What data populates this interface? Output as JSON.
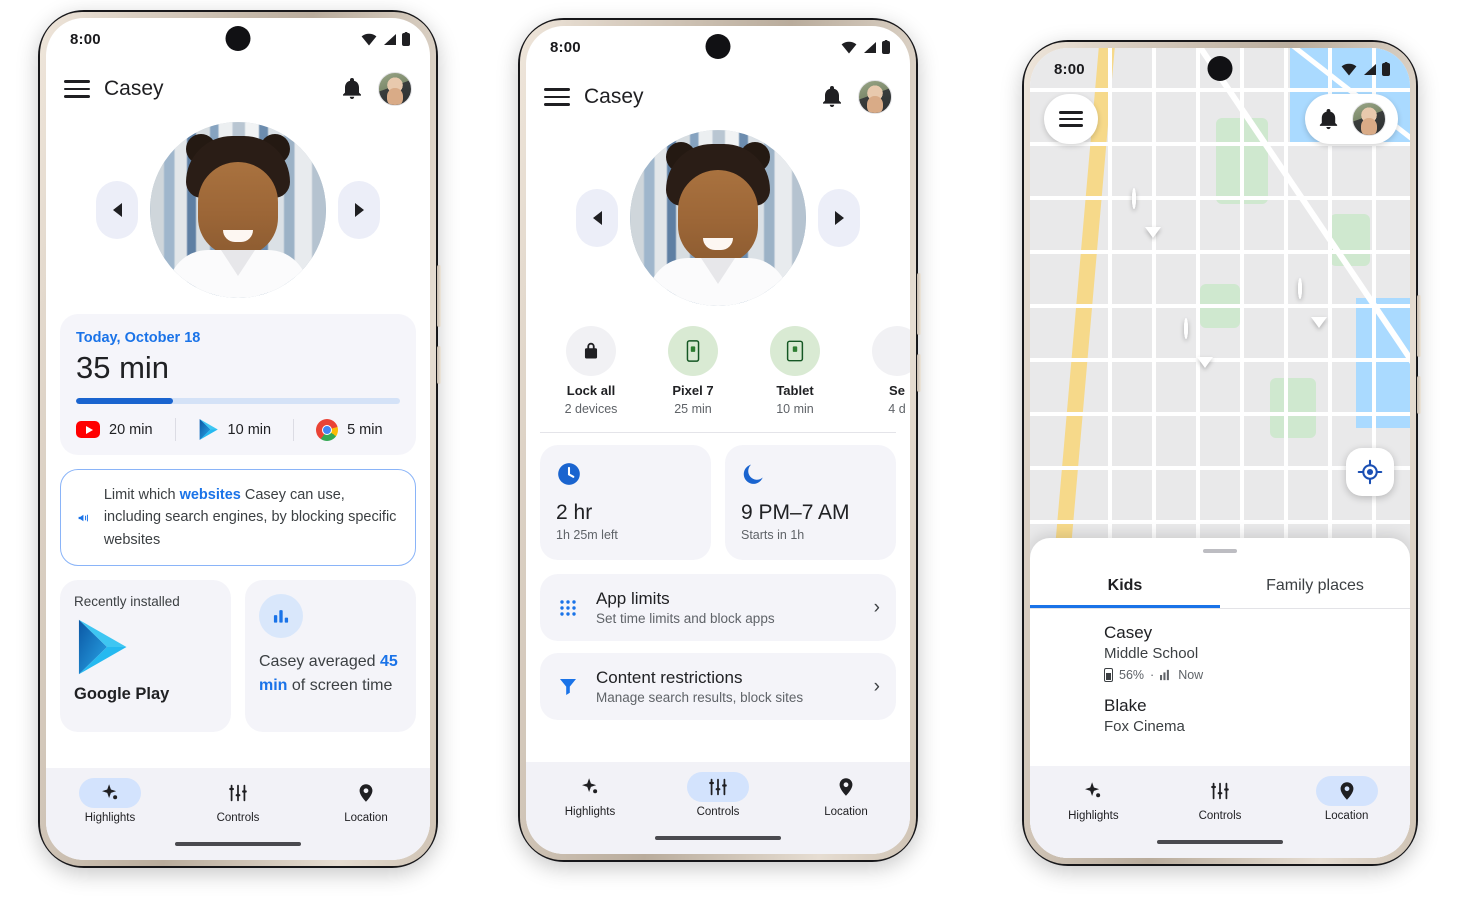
{
  "meta": {
    "accent_blue": "#1a73e8",
    "accent_blue_dark": "#1a64cf",
    "chip_blue": "#d3e3fd",
    "green": "#d9ead3"
  },
  "phone1": {
    "status": {
      "time": "8:00",
      "icons": [
        "wifi-icon",
        "signal-icon",
        "battery-icon"
      ]
    },
    "appbar": {
      "menu": "menu-icon",
      "title": "Casey",
      "bell": "notification-bell-icon",
      "avatar": "parent-avatar"
    },
    "carousel": {
      "prev": "◀",
      "next": "▶",
      "child": "Casey"
    },
    "screentime": {
      "date": "Today, October 18",
      "total": "35 min",
      "progress_percent": 30,
      "apps": [
        {
          "icon": "youtube-icon",
          "time": "20 min"
        },
        {
          "icon": "google-play-icon",
          "time": "10 min"
        },
        {
          "icon": "chrome-icon",
          "time": "5 min"
        }
      ]
    },
    "promo": {
      "icon": "megaphone-icon",
      "text_before": "Limit which ",
      "highlight": "websites",
      "text_after": " Casey can use, including search engines, by blocking specific websites"
    },
    "cards": {
      "recent": {
        "label": "Recently installed",
        "icon": "google-play-icon",
        "app_name": "Google Play"
      },
      "average": {
        "icon": "bar-chart-icon",
        "text_before": "Casey averaged ",
        "highlight": "45 min",
        "text_after": " of screen time"
      }
    },
    "nav": [
      {
        "label": "Highlights",
        "icon": "sparkle-icon",
        "active": true
      },
      {
        "label": "Controls",
        "icon": "sliders-icon",
        "active": false
      },
      {
        "label": "Location",
        "icon": "location-pin-icon",
        "active": false
      }
    ]
  },
  "phone2": {
    "status": {
      "time": "8:00"
    },
    "appbar": {
      "title": "Casey"
    },
    "devices": [
      {
        "name": "Lock all",
        "sub": "2 devices",
        "icon": "lock-icon",
        "style": "grey"
      },
      {
        "name": "Pixel 7",
        "sub": "25 min",
        "icon": "phone-device-icon",
        "style": "green"
      },
      {
        "name": "Tablet",
        "sub": "10 min",
        "icon": "tablet-device-icon",
        "style": "green"
      },
      {
        "name": "Se",
        "sub": "4 d",
        "icon": "device-icon",
        "style": "grey"
      }
    ],
    "timecards": [
      {
        "icon": "clock-icon",
        "title": "2 hr",
        "sub": "1h 25m left"
      },
      {
        "icon": "moon-icon",
        "title": "9 PM–7 AM",
        "sub": "Starts in 1h"
      }
    ],
    "rows": [
      {
        "icon": "grid-apps-icon",
        "title": "App limits",
        "desc": "Set time limits and block apps",
        "chevron": "›"
      },
      {
        "icon": "filter-icon",
        "title": "Content restrictions",
        "desc": "Manage search results, block sites",
        "chevron": "›"
      }
    ],
    "nav": [
      {
        "label": "Highlights",
        "icon": "sparkle-icon",
        "active": false
      },
      {
        "label": "Controls",
        "icon": "sliders-icon",
        "active": true
      },
      {
        "label": "Location",
        "icon": "location-pin-icon",
        "active": false
      }
    ]
  },
  "phone3": {
    "status": {
      "time": "8:00"
    },
    "map": {
      "menu_icon": "menu-icon",
      "bell_icon": "notification-bell-icon",
      "avatar": "parent-avatar",
      "recenter_icon": "my-location-icon",
      "pins": [
        "pin-blake",
        "pin-parent",
        "pin-casey"
      ]
    },
    "sheet": {
      "tabs": [
        {
          "label": "Kids",
          "active": true
        },
        {
          "label": "Family places",
          "active": false
        }
      ],
      "kids": [
        {
          "name": "Casey",
          "place": "Middle School",
          "battery": "56%",
          "dot": "·",
          "signal_icon": "signal-bars-icon",
          "updated": "Now"
        },
        {
          "name": "Blake",
          "place": "Fox Cinema",
          "battery": "",
          "dot": "",
          "signal_icon": "",
          "updated": ""
        }
      ]
    },
    "nav": [
      {
        "label": "Highlights",
        "icon": "sparkle-icon",
        "active": false
      },
      {
        "label": "Controls",
        "icon": "sliders-icon",
        "active": false
      },
      {
        "label": "Location",
        "icon": "location-pin-icon",
        "active": true
      }
    ]
  }
}
